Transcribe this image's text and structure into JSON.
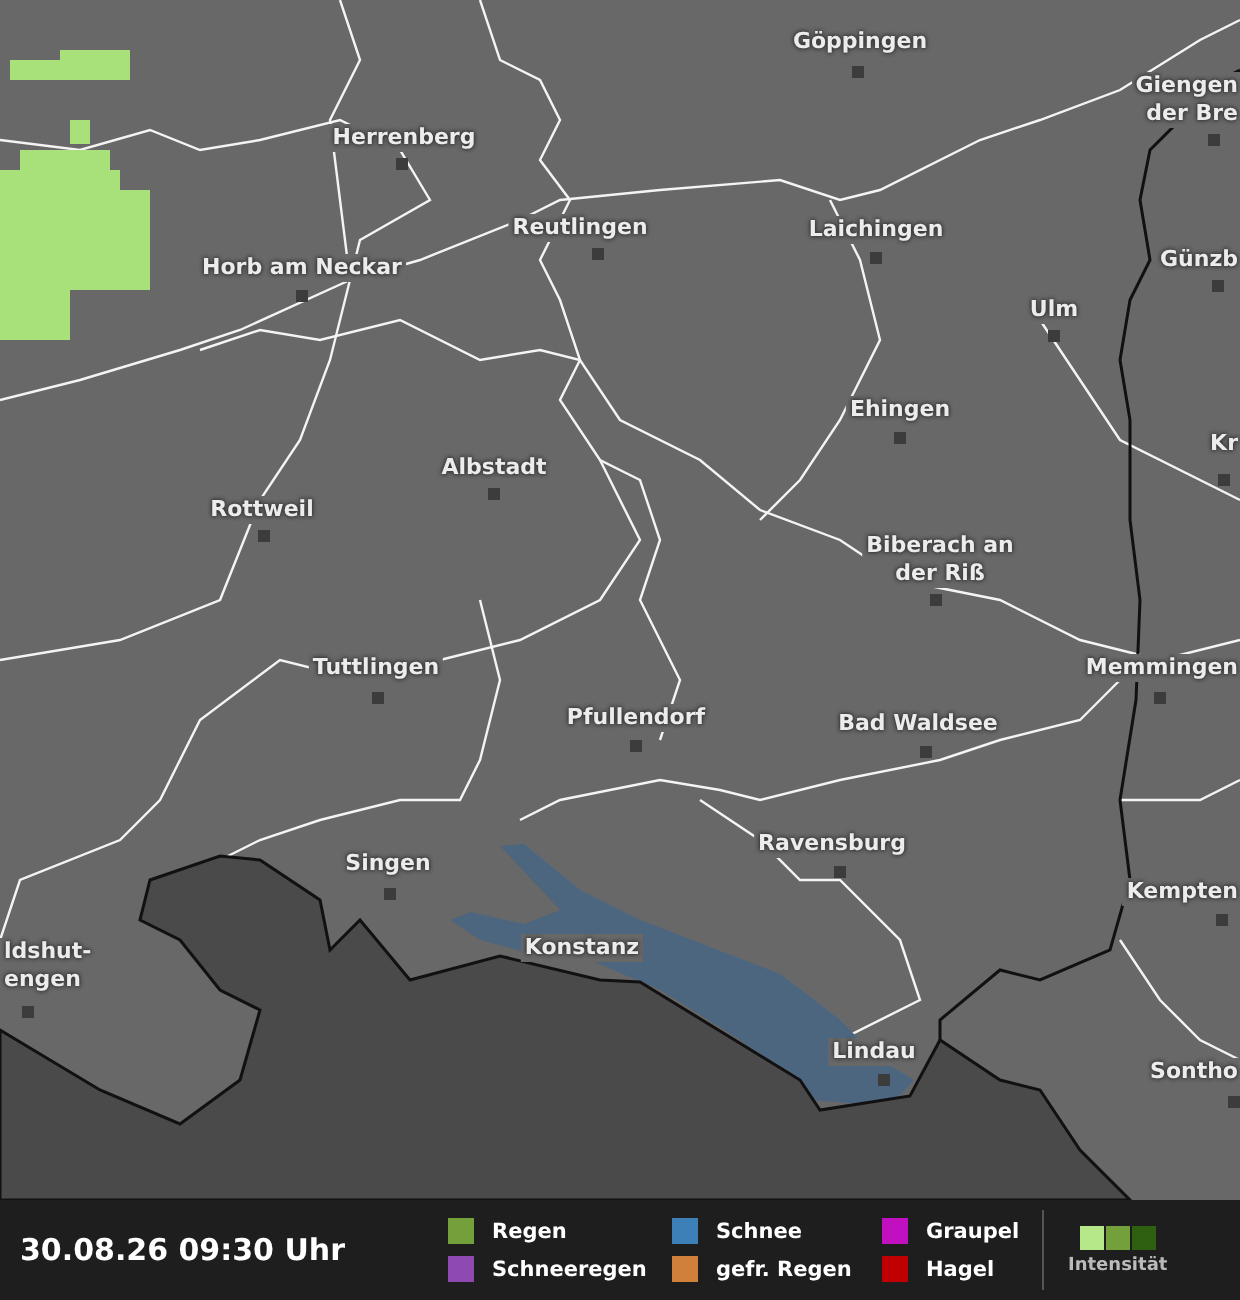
{
  "map": {
    "cities": [
      {
        "name": "Göppingen"
      },
      {
        "name": "Herrenberg"
      },
      {
        "name": "Giengen\nder Bre"
      },
      {
        "name": "Reutlingen"
      },
      {
        "name": "Laichingen"
      },
      {
        "name": "Horb am Neckar"
      },
      {
        "name": "Günzb"
      },
      {
        "name": "Ulm"
      },
      {
        "name": "Ehingen"
      },
      {
        "name": "Kr"
      },
      {
        "name": "Albstadt"
      },
      {
        "name": "Rottweil"
      },
      {
        "name": "Biberach an\nder Riß"
      },
      {
        "name": "Tuttlingen"
      },
      {
        "name": "Memmingen"
      },
      {
        "name": "Pfullendorf"
      },
      {
        "name": "Bad Waldsee"
      },
      {
        "name": "Ravensburg"
      },
      {
        "name": "Singen"
      },
      {
        "name": "Kempten"
      },
      {
        "name": "Konstanz"
      },
      {
        "name": "ldshut-\nengen"
      },
      {
        "name": "Lindau"
      },
      {
        "name": "Sontho"
      }
    ]
  },
  "footer": {
    "timestamp": "30.08.26 09:30 Uhr",
    "legend": [
      {
        "label": "Regen",
        "color": "#74a03c"
      },
      {
        "label": "Schneeregen",
        "color": "#8e4ab0"
      },
      {
        "label": "Schnee",
        "color": "#3d80b8"
      },
      {
        "label": "gefr. Regen",
        "color": "#d0803a"
      },
      {
        "label": "Graupel",
        "color": "#c010c0"
      },
      {
        "label": "Hagel",
        "color": "#c00000"
      }
    ],
    "intensity": {
      "label": "Intensität",
      "levels": [
        {
          "color": "#b6e88a"
        },
        {
          "color": "#74a03c"
        },
        {
          "color": "#2e6010"
        }
      ]
    }
  }
}
